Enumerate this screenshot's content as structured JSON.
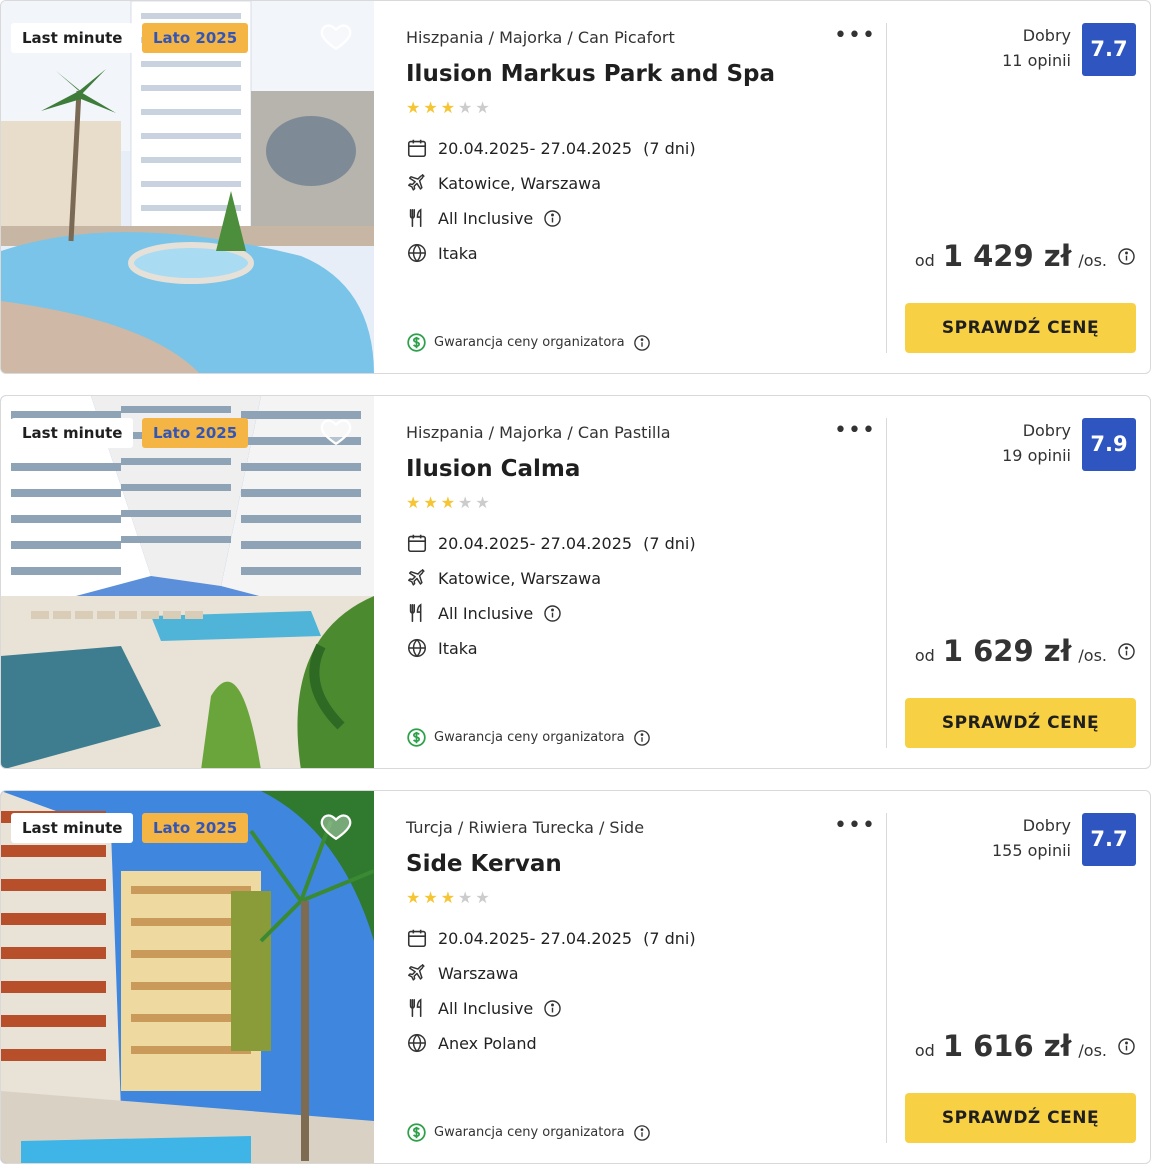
{
  "colors": {
    "accent_yellow": "#f8d044",
    "season_badge_bg": "#f4b544",
    "season_badge_text": "#3355b5",
    "score_bg": "#2f55c1",
    "star_filled": "#f5c534",
    "star_empty": "#cccccc",
    "guarantee_green": "#2ea04a"
  },
  "offers": [
    {
      "badge_primary": "Last minute",
      "badge_season": "Lato 2025",
      "breadcrumb": "Hiszpania / Majorka / Can Picafort",
      "title": "Ilusion Markus Park and Spa",
      "stars_filled": 3,
      "stars_total": 5,
      "dates": "20.04.2025- 27.04.2025",
      "duration": "(7 dni)",
      "departure": "Katowice, Warszawa",
      "board": "All Inclusive",
      "operator": "Itaka",
      "guarantee": "Gwarancja ceny organizatora",
      "rating_label": "Dobry",
      "reviews": "11 opinii",
      "score": "7.7",
      "price_prefix": "od",
      "price": "1 429 zł",
      "price_suffix": "/os.",
      "cta": "SPRAWDŹ CENĘ",
      "photo_scene": "hotel-tower-pool"
    },
    {
      "badge_primary": "Last minute",
      "badge_season": "Lato 2025",
      "breadcrumb": "Hiszpania / Majorka / Can Pastilla",
      "title": "Ilusion Calma",
      "stars_filled": 3,
      "stars_total": 5,
      "dates": "20.04.2025- 27.04.2025",
      "duration": "(7 dni)",
      "departure": "Katowice, Warszawa",
      "board": "All Inclusive",
      "operator": "Itaka",
      "guarantee": "Gwarancja ceny organizatora",
      "rating_label": "Dobry",
      "reviews": "19 opinii",
      "score": "7.9",
      "price_prefix": "od",
      "price": "1 629 zł",
      "price_suffix": "/os.",
      "cta": "SPRAWDŹ CENĘ",
      "photo_scene": "hotel-courtyard-pool"
    },
    {
      "badge_primary": "Last minute",
      "badge_season": "Lato 2025",
      "breadcrumb": "Turcja / Riwiera Turecka / Side",
      "title": "Side Kervan",
      "stars_filled": 3,
      "stars_total": 5,
      "dates": "20.04.2025- 27.04.2025",
      "duration": "(7 dni)",
      "departure": "Warszawa",
      "board": "All Inclusive",
      "operator": "Anex Poland",
      "guarantee": "Gwarancja ceny organizatora",
      "rating_label": "Dobry",
      "reviews": "155 opinii",
      "score": "7.7",
      "price_prefix": "od",
      "price": "1 616 zł",
      "price_suffix": "/os.",
      "cta": "SPRAWDŹ CENĘ",
      "photo_scene": "hotel-balconies-palm"
    }
  ]
}
